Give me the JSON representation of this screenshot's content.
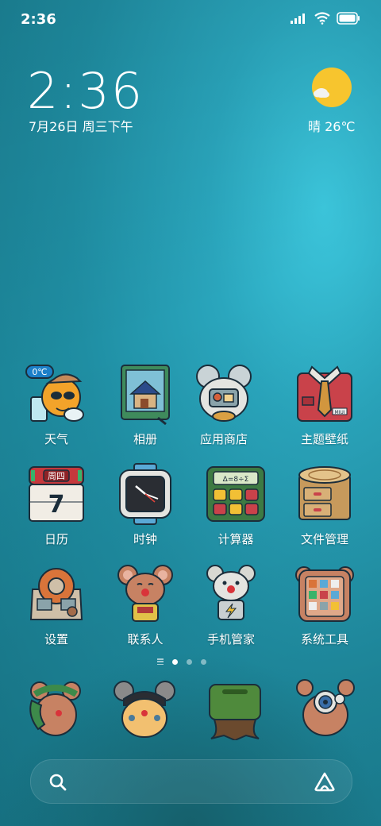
{
  "status_bar": {
    "time": "2:36"
  },
  "clock_widget": {
    "time": "2:36",
    "date": "7月26日 周三下午",
    "weather": "晴 26℃"
  },
  "apps": [
    {
      "label": "天气",
      "badge": "0℃"
    },
    {
      "label": "相册"
    },
    {
      "label": "应用商店"
    },
    {
      "label": "主题壁纸",
      "tag": "MIUI"
    },
    {
      "label": "日历",
      "header": "周四",
      "day": "7"
    },
    {
      "label": "时钟"
    },
    {
      "label": "计算器",
      "display": "Δ=8÷Σ"
    },
    {
      "label": "文件管理"
    },
    {
      "label": "设置"
    },
    {
      "label": "联系人"
    },
    {
      "label": "手机管家"
    },
    {
      "label": "系统工具"
    }
  ],
  "dock": [
    {
      "icon": "phone-mouse-icon"
    },
    {
      "icon": "messages-mouse-icon"
    },
    {
      "icon": "browser-stump-icon"
    },
    {
      "icon": "camera-mouse-icon"
    }
  ],
  "pager": {
    "pages": 3,
    "active": 1
  },
  "colors": {
    "sun": "#f7c52e",
    "wallpaper": "#1f8ea3"
  }
}
